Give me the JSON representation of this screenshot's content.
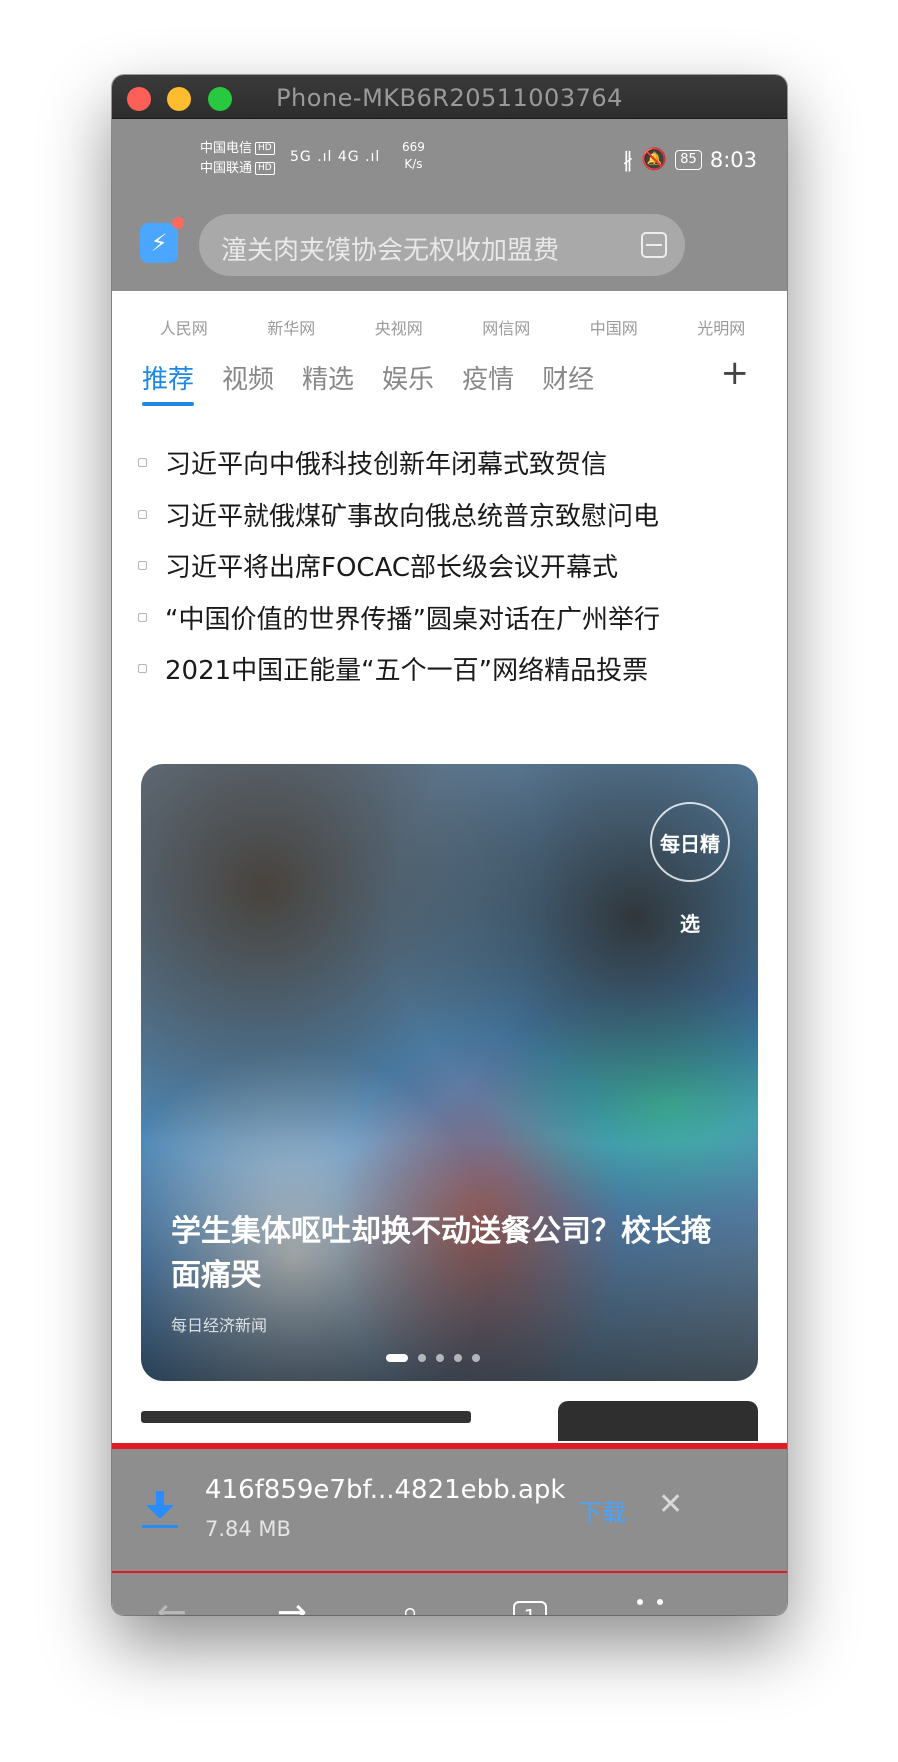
{
  "window": {
    "title": "Phone-MKB6R20511003764"
  },
  "status_bar": {
    "carrier1": "中国电信",
    "carrier2": "中国联通",
    "hd": "HD",
    "network": "5G .ıl 4G .ıl",
    "net_speed_value": "669",
    "net_speed_unit": "K/s",
    "battery": "85",
    "time": "8:03"
  },
  "search": {
    "placeholder": "潼关肉夹馍协会无权收加盟费"
  },
  "sources": [
    "人民网",
    "新华网",
    "央视网",
    "网信网",
    "中国网",
    "光明网"
  ],
  "tabs": [
    "推荐",
    "视频",
    "精选",
    "娱乐",
    "疫情",
    "财经"
  ],
  "active_tab": "推荐",
  "headlines": [
    "习近平向中俄科技创新年闭幕式致贺信",
    "习近平就俄煤矿事故向俄总统普京致慰问电",
    "习近平将出席FOCAC部长级会议开幕式",
    "“中国价值的世界传播”圆桌对话在广州举行",
    "2021中国正能量“五个一百”网络精品投票"
  ],
  "feature": {
    "badge": "每日精选",
    "title": "学生集体呕吐却换不动送餐公司？校长掩面痛哭",
    "source": "每日经济新闻",
    "carousel_count": 5,
    "carousel_active": 1
  },
  "download": {
    "filename": "416f859e7bf...4821ebb.apk",
    "size": "7.84 MB",
    "button_label": "下载",
    "close_glyph": "✕"
  },
  "navbar": {
    "back_glyph": "←",
    "forward_glyph": "→",
    "search_glyph": "🔍",
    "tab_count": "1"
  },
  "colors": {
    "accent": "#1e88e5",
    "download_link": "#4aa3ff",
    "highlight_border": "#e01b24",
    "dim_overlay": "#8e8e8e"
  }
}
